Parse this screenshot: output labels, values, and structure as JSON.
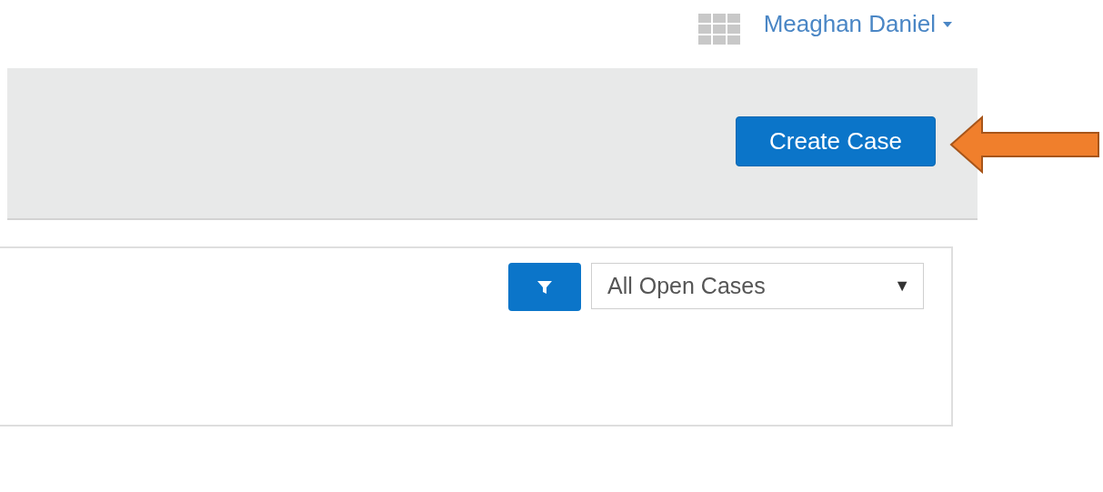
{
  "header": {
    "user_name": "Meaghan Daniel"
  },
  "toolbar": {
    "primary_button": "Create Case"
  },
  "list_panel": {
    "view_select": {
      "value": "All Open Cases",
      "arrow": "▼"
    }
  }
}
